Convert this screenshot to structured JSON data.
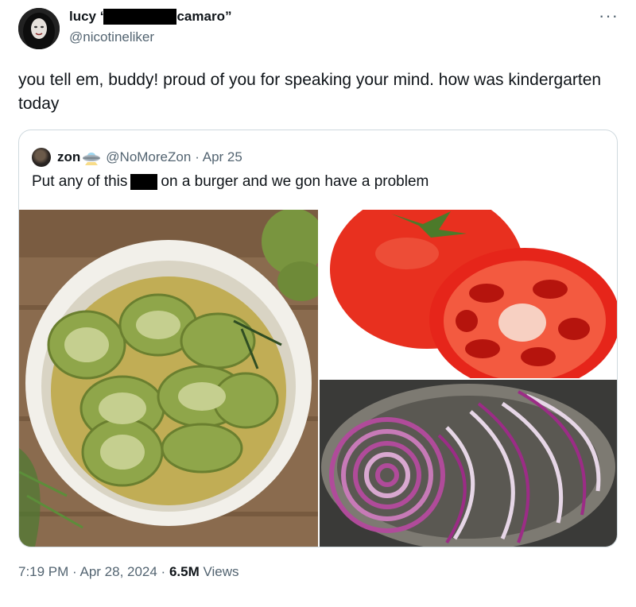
{
  "author": {
    "name_start": "lucy ‘",
    "name_end": "camaro”",
    "handle": "@nicotineliker"
  },
  "more_label": "···",
  "tweet": {
    "text": "you tell em, buddy! proud of you for speaking your mind. how was kindergarten today"
  },
  "quote": {
    "name": "zon",
    "handle": "@NoMoreZon",
    "date": "· Apr 25",
    "text_before": "Put any of this",
    "text_after": "on a burger and we gon have a problem",
    "images": [
      "pickles",
      "tomato",
      "red onion"
    ]
  },
  "footer": {
    "time": "7:19 PM",
    "date": " · Apr 28, 2024 · ",
    "views_count": "6.5M",
    "views_label": " Views"
  },
  "colors": {
    "text": "#0f1419",
    "secondary": "#536471",
    "border": "#cfd9de"
  },
  "icons": [
    "more-icon",
    "ufo-emoji-icon"
  ]
}
